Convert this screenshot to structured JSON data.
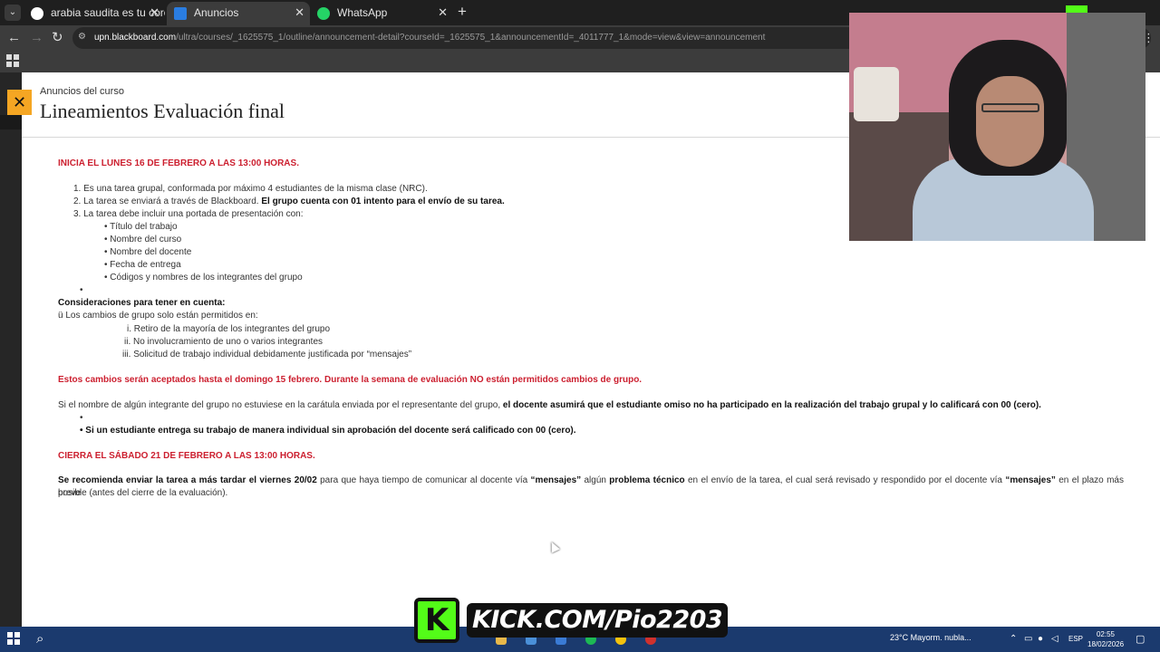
{
  "browser": {
    "tabs": [
      {
        "title": "arabia saudita es tu corona que",
        "active": false
      },
      {
        "title": "Anuncios",
        "active": true
      },
      {
        "title": "WhatsApp",
        "active": false
      }
    ],
    "url_host": "upn.blackboard.com",
    "url_path": "/ultra/courses/_1625575_1/outline/announcement-detail?courseId=_1625575_1&announcementId=_4011777_1&mode=view&view=announcement"
  },
  "panel": {
    "breadcrumb": "Anuncios del curso",
    "title": "Lineamientos Evaluación final"
  },
  "content": {
    "start_notice": "INICIA EL LUNES 16 DE FEBRERO A LAS 13:00 HORAS.",
    "item1": "1. Es una tarea grupal, conformada por máximo 4 estudiantes de la misma clase (NRC).",
    "item2_a": "2. La tarea se enviará a través de Blackboard. ",
    "item2_b": "El grupo cuenta con 01 intento para el envío de su tarea.",
    "item3": "3. La tarea debe incluir una portada de presentación con:",
    "cover_items": [
      "• Título del trabajo",
      "• Nombre del curso",
      "• Nombre del docente",
      "• Fecha de entrega",
      "• Códigos y nombres de los integrantes del grupo"
    ],
    "empty_bullet": "•",
    "considerations_heading": "Consideraciones para tener en cuenta:",
    "group_changes_intro": "ü Los cambios de grupo solo están permitidos en:",
    "group_changes": [
      "i. Retiro de la mayoría de los integrantes del grupo",
      "ii. No involucramiento de uno o varios integrantes",
      "iii. Solicitud de trabajo individual debidamente justificada por “mensajes”"
    ],
    "changes_deadline": "Estos cambios serán aceptados hasta el domingo 15 febrero. Durante la semana de evaluación NO están permitidos cambios de grupo.",
    "omission_a": "Si el nombre de algún integrante del grupo no estuviese en la carátula enviada por el representante del grupo, ",
    "omission_b": "el docente asumirá que el estudiante omiso no ha participado en la realización del trabajo grupal y lo calificará con 00 (cero).",
    "individual_bullet": "•",
    "individual_warning": "• Si un estudiante entrega su trabajo de manera individual sin aprobación del docente será calificado con 00 (cero).",
    "close_notice": "CIERRA EL SÁBADO 21 DE FEBRERO A LAS 13:00 HORAS.",
    "rec_1": "Se recomienda enviar la tarea a más tardar el viernes 20/02",
    "rec_2": " para que haya tiempo de comunicar al docente vía ",
    "rec_3": "“mensajes”",
    "rec_4": " algún ",
    "rec_5": "problema técnico",
    "rec_6": " en el envío de la tarea, el cual será revisado y respondido por el docente vía ",
    "rec_7": "“mensajes”",
    "rec_8": " en el plazo más breve",
    "rec_9": "posible (antes del cierre de la evaluación)."
  },
  "overlay": {
    "kick_logo": "K",
    "kick_text": "KICK.COM/Pio2203"
  },
  "taskbar": {
    "weather": "23°C  Mayorm. nubla...",
    "language": "ESP",
    "time": "02:55",
    "date": "18/02/2026"
  },
  "colors": {
    "accent_red": "#cc1f2f",
    "close_button": "#f5a623",
    "kick_green": "#53fc18",
    "taskbar": "#1b3a6e"
  }
}
